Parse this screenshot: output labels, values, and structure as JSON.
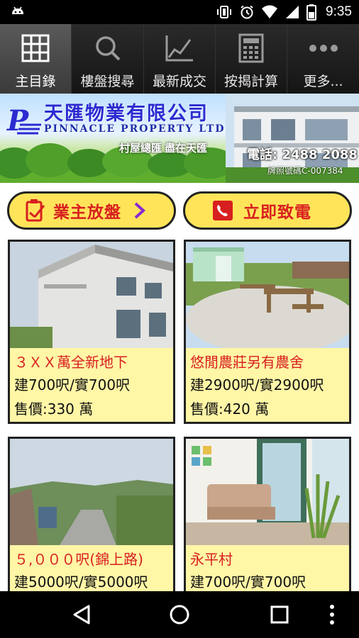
{
  "status_bar": {
    "time": "9:35"
  },
  "nav_tabs": [
    {
      "label": "主目錄",
      "icon": "grid-icon",
      "active": true
    },
    {
      "label": "樓盤搜尋",
      "icon": "search-icon",
      "active": false
    },
    {
      "label": "最新成交",
      "icon": "line-chart-icon",
      "active": false
    },
    {
      "label": "按揭計算",
      "icon": "calculator-icon",
      "active": false
    },
    {
      "label": "更多...",
      "icon": "more-dots-icon",
      "active": false
    }
  ],
  "banner": {
    "company_name": "天匯物業有限公司",
    "company_name_en": "PINNACLE PROPERTY LTD",
    "slogan_1": "村屋總匯",
    "slogan_2": "盡在天匯",
    "phone": "電話: 2488 2088",
    "license": "牌照號碼C-007384"
  },
  "actions": {
    "owner_listing": "業主放盤",
    "call_now": "立即致電"
  },
  "listings": [
    {
      "title": "３ＸＸ萬全新地下",
      "area": "建700呎/實700呎",
      "price": "售價:330 萬"
    },
    {
      "title": "悠閒農莊另有農舍",
      "area": "建2900呎/實2900呎",
      "price": "售價:420 萬"
    },
    {
      "title": "５,０００呎(錦上路)",
      "area": "建5000呎/實5000呎",
      "price": ""
    },
    {
      "title": "永平村",
      "area": "建700呎/實700呎",
      "price": ""
    }
  ],
  "colors": {
    "accent_yellow": "#ffe45a",
    "accent_red": "#d81f1f",
    "card_bg": "#fff6a6",
    "brand_blue": "#2b2bd0"
  }
}
